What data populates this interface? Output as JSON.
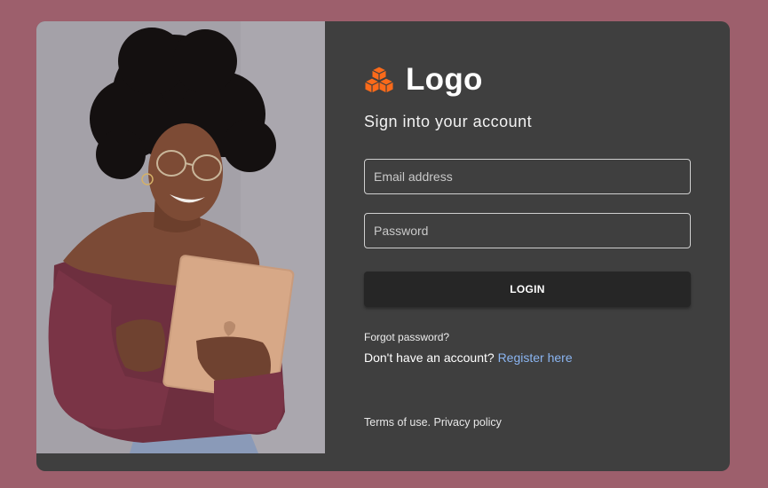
{
  "brand": {
    "logo_text": "Logo",
    "logo_icon": "cubes-icon",
    "accent_color": "#fb6a1a"
  },
  "page": {
    "background_color": "#9d5f6c",
    "card_color": "#3f3f3f"
  },
  "form": {
    "subtitle": "Sign into your account",
    "email_placeholder": "Email address",
    "email_value": "",
    "password_placeholder": "Password",
    "password_value": "",
    "login_label": "LOGIN",
    "forgot_label": "Forgot password?",
    "no_account_text": "Don't have an account?",
    "register_label": "Register here",
    "link_color": "#8ab4f0"
  },
  "footer": {
    "terms_label": "Terms of use.",
    "privacy_label": "Privacy policy"
  }
}
